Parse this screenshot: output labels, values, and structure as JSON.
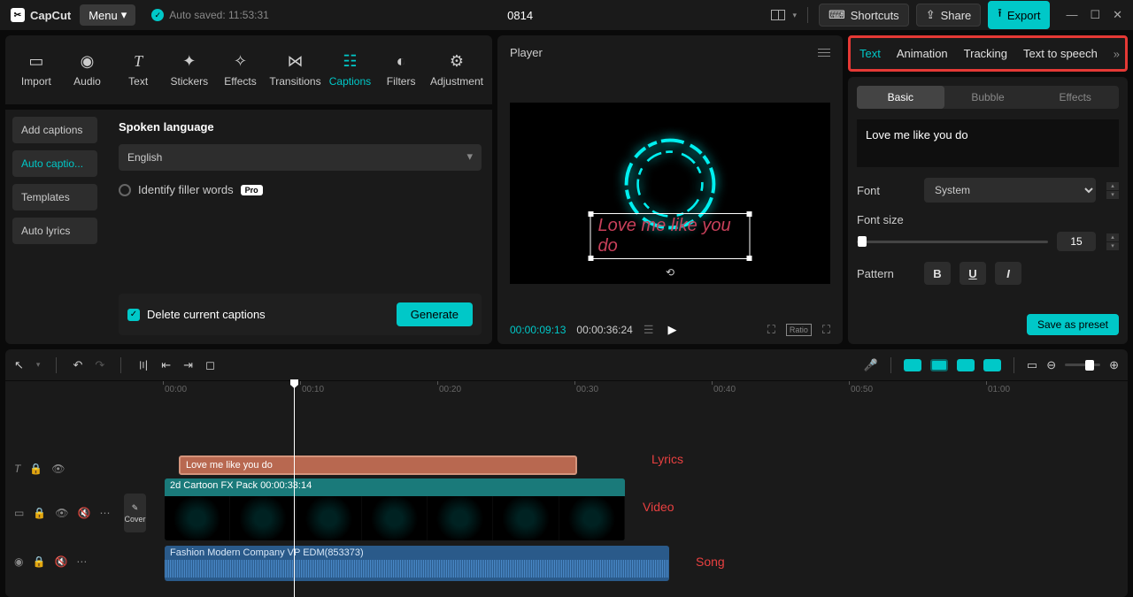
{
  "app": {
    "name": "CapCut",
    "menu": "Menu",
    "autosave": "Auto saved: 11:53:31",
    "doc_title": "0814"
  },
  "titlebar": {
    "shortcuts": "Shortcuts",
    "share": "Share",
    "export": "Export"
  },
  "media_tabs": {
    "import": "Import",
    "audio": "Audio",
    "text": "Text",
    "stickers": "Stickers",
    "effects": "Effects",
    "transitions": "Transitions",
    "captions": "Captions",
    "filters": "Filters",
    "adjustment": "Adjustment"
  },
  "caption_side": {
    "add": "Add captions",
    "auto": "Auto captio...",
    "templates": "Templates",
    "autolyrics": "Auto lyrics"
  },
  "captions_panel": {
    "spoken_label": "Spoken language",
    "language": "English",
    "identify": "Identify filler words",
    "pro": "Pro",
    "delete": "Delete current captions",
    "generate": "Generate"
  },
  "player": {
    "title": "Player",
    "overlay_text": "Love me like you do",
    "tc_current": "00:00:09:13",
    "tc_total": "00:00:36:24",
    "ratio": "Ratio"
  },
  "inspector_tabs": {
    "text": "Text",
    "animation": "Animation",
    "tracking": "Tracking",
    "tts": "Text to speech"
  },
  "inspector_sub": {
    "basic": "Basic",
    "bubble": "Bubble",
    "effects": "Effects"
  },
  "inspector": {
    "text_value": "Love me like you do",
    "font_label": "Font",
    "font_value": "System",
    "size_label": "Font size",
    "size_value": "15",
    "pattern_label": "Pattern",
    "save_preset": "Save as preset"
  },
  "ruler": {
    "t0": "00:00",
    "t1": "00:10",
    "t2": "00:20",
    "t3": "00:30",
    "t4": "00:40",
    "t5": "00:50",
    "t6": "01:00"
  },
  "tracks": {
    "cover": "Cover",
    "lyrics_text": "Love me like you do",
    "video_label": "2d Cartoon FX Pack  00:00:33:14",
    "audio_label": "Fashion Modern Company VP EDM(853373)"
  },
  "annotations": {
    "lyrics": "Lyrics",
    "video": "Video",
    "song": "Song"
  }
}
